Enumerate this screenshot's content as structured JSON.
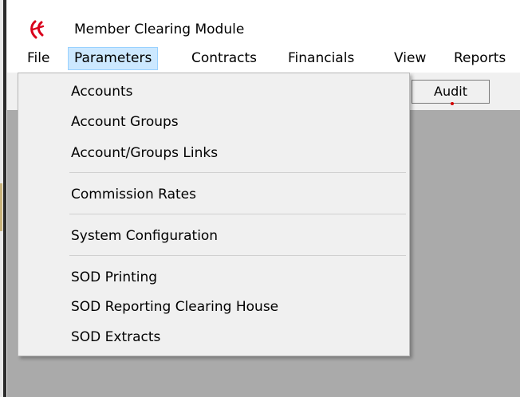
{
  "window": {
    "title": "Member Clearing Module",
    "app_icon": "app-logo-icon"
  },
  "menubar": {
    "items": [
      {
        "label": "File"
      },
      {
        "label": "Parameters"
      },
      {
        "label": "Contracts"
      },
      {
        "label": "Financials"
      },
      {
        "label": "View"
      },
      {
        "label": "Reports"
      }
    ],
    "active": "Parameters"
  },
  "toolbar": {
    "audit_label": "Audit"
  },
  "parameters_menu": {
    "items": [
      {
        "label": "Accounts"
      },
      {
        "label": "Account Groups"
      },
      {
        "label": "Account/Groups Links"
      },
      {
        "label": "Commission Rates"
      },
      {
        "label": "System Configuration"
      },
      {
        "label": "SOD Printing"
      },
      {
        "label": "SOD Reporting Clearing House"
      },
      {
        "label": "SOD Extracts"
      }
    ]
  },
  "colors": {
    "menu_highlight": "#cce8ff",
    "menu_highlight_border": "#99d1ff",
    "workspace": "#aaaaaa",
    "dropdown_bg": "#f0f0f0",
    "icon_red": "#d9001b"
  }
}
